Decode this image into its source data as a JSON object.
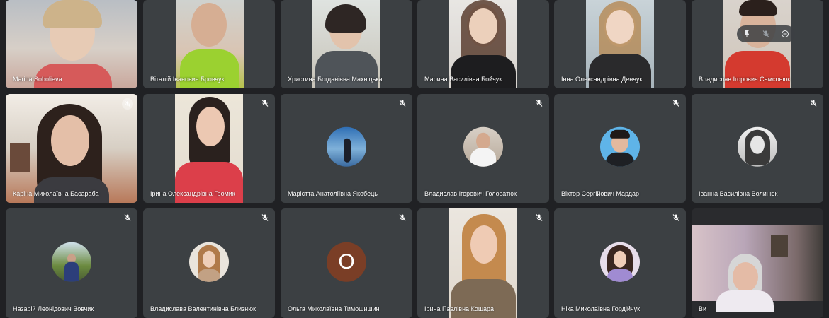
{
  "participants": [
    {
      "name": "Marina Sobolieva"
    },
    {
      "name": "Віталій Іванович Бровчук"
    },
    {
      "name": "Христина Богданівна Махніцька"
    },
    {
      "name": "Марина Василівна Бойчук"
    },
    {
      "name": "Інна Олександрівна Денчук"
    },
    {
      "name": "Владислав Ігорович Самсонюк"
    },
    {
      "name": "Каріна Миколаївна Басараба"
    },
    {
      "name": "Ірина Олександрівна Громик"
    },
    {
      "name": "Марієтта Анатоліївна Якобець"
    },
    {
      "name": "Владислав Ігорович Головатюк"
    },
    {
      "name": "Віктор Сергійович Мардар"
    },
    {
      "name": "Іванна Василівна Волинюк"
    },
    {
      "name": "Назарій Леонідович Вовчик"
    },
    {
      "name": "Владислава Валентинівна Близнюк"
    },
    {
      "name": "Ольга Миколаївна Тимошишин",
      "avatar_letter": "О"
    },
    {
      "name": "Ірина Павлівна Кошара"
    },
    {
      "name": "Ніка Миколаївна Гордійчук"
    },
    {
      "name": "Ви"
    }
  ],
  "colors": {
    "background": "#202124",
    "tile": "#3c4043",
    "active_border": "#8ab4f8",
    "letter_avatar": "#7a3e26"
  }
}
